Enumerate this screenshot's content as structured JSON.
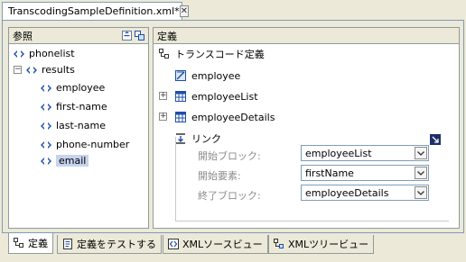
{
  "editor": {
    "tab_title": "TranscodingSampleDefinition.xml*"
  },
  "reference_panel": {
    "title": "参照",
    "tree": [
      {
        "label": "phonelist"
      },
      {
        "label": "results"
      },
      {
        "label": "employee"
      },
      {
        "label": "first-name"
      },
      {
        "label": "last-name"
      },
      {
        "label": "phone-number"
      },
      {
        "label": "email"
      }
    ]
  },
  "definition_panel": {
    "title": "定義",
    "root_label": "トランスコード定義",
    "items": [
      {
        "label": "employee"
      },
      {
        "label": "employeeList"
      },
      {
        "label": "employeeDetails"
      }
    ],
    "link": {
      "label": "リンク",
      "fields": [
        {
          "label": "開始ブロック:",
          "value": "employeeList"
        },
        {
          "label": "開始要素:",
          "value": "firstName"
        },
        {
          "label": "終了ブロック:",
          "value": "employeeDetails"
        }
      ]
    }
  },
  "bottom_tabs": [
    {
      "label": "定義"
    },
    {
      "label": "定義をテストする"
    },
    {
      "label": "XMLソースビュー"
    },
    {
      "label": "XMLツリービュー"
    }
  ],
  "colors": {
    "background": "#ece9d8",
    "selection": "#c7d3ed",
    "border": "#7f9db9",
    "icon_blue": "#1f4fa8"
  }
}
